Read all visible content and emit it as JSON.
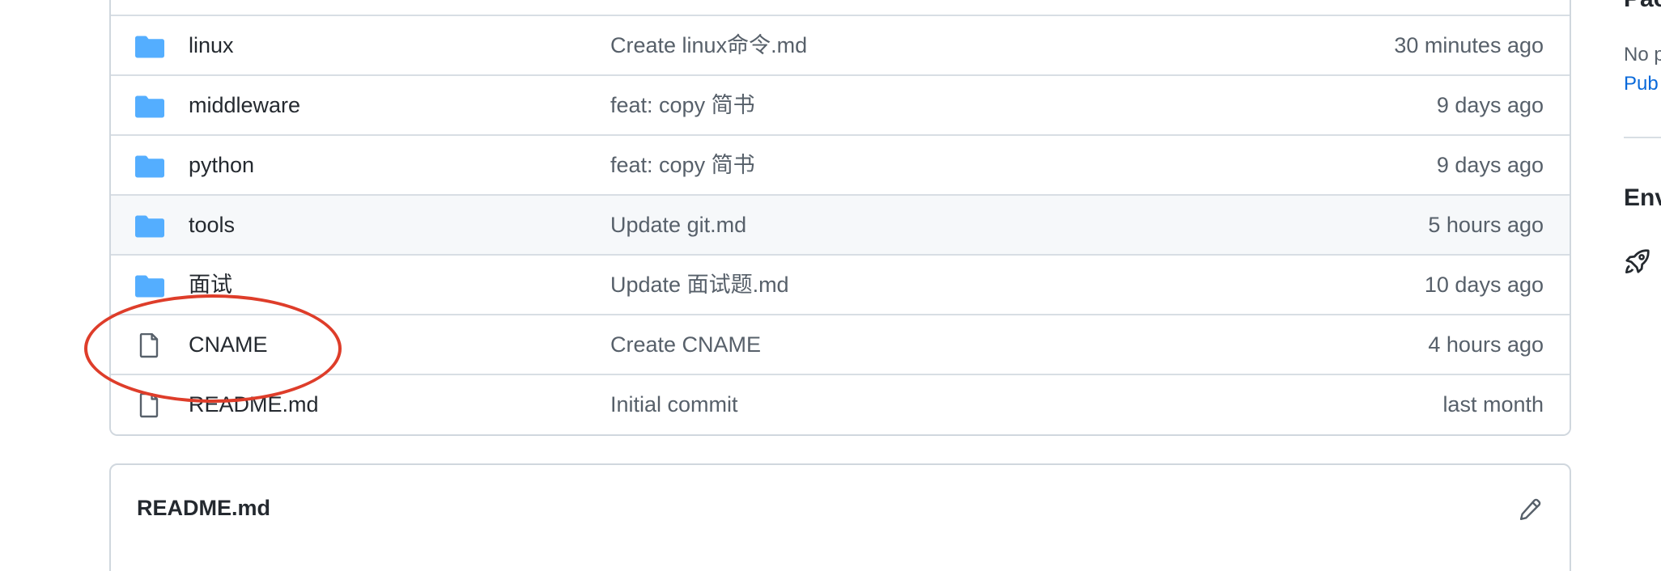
{
  "files": [
    {
      "type": "folder",
      "name": "linux",
      "message": "Create linux命令.md",
      "time": "30 minutes ago"
    },
    {
      "type": "folder",
      "name": "middleware",
      "message": "feat: copy 简书",
      "time": "9 days ago"
    },
    {
      "type": "folder",
      "name": "python",
      "message": "feat: copy 简书",
      "time": "9 days ago"
    },
    {
      "type": "folder",
      "name": "tools",
      "message": "Update git.md",
      "time": "5 hours ago"
    },
    {
      "type": "folder",
      "name": "面试",
      "message": "Update 面试题.md",
      "time": "10 days ago"
    },
    {
      "type": "file",
      "name": "CNAME",
      "message": "Create CNAME",
      "time": "4 hours ago"
    },
    {
      "type": "file",
      "name": "README.md",
      "message": "Initial commit",
      "time": "last month"
    }
  ],
  "readme": {
    "title": "README.md",
    "edit_icon": "pencil-icon"
  },
  "sidebar": {
    "top_heading": "Pac",
    "no_text": "No p",
    "publish_link": "Pub",
    "env_heading": "Env",
    "rocket_icon": "rocket-icon"
  },
  "colors": {
    "folder": "#54aeff",
    "file_icon": "#57606a",
    "annotation": "#de3d2a",
    "link": "#0969da",
    "row_hover": "#f6f8fa"
  }
}
